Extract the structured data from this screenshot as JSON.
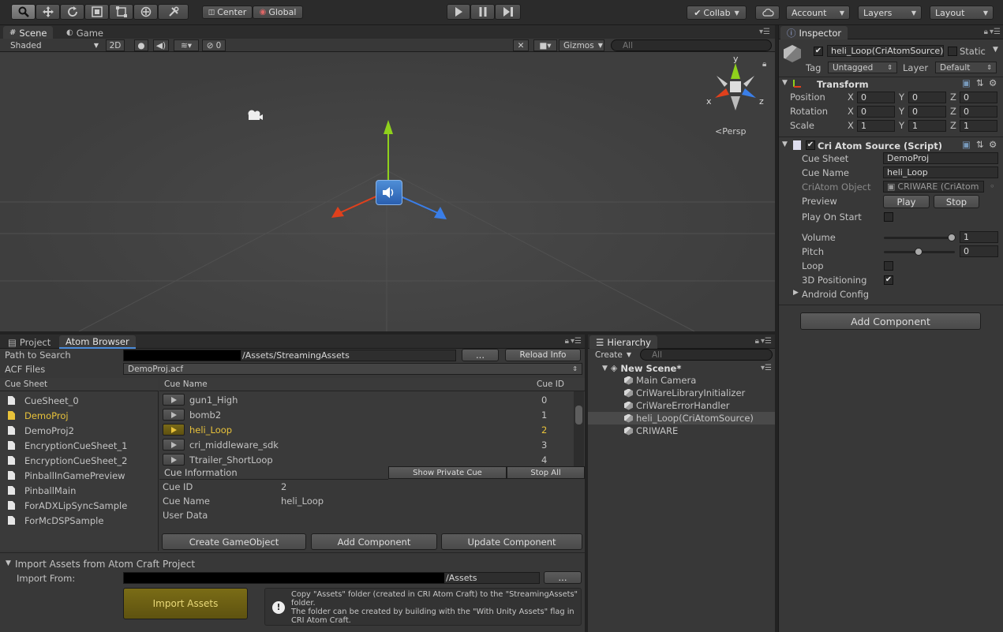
{
  "toolbar": {
    "pivot": "Center",
    "space": "Global",
    "collab": "Collab",
    "account": "Account",
    "layers": "Layers",
    "layout": "Layout"
  },
  "scene": {
    "tab_scene": "Scene",
    "tab_game": "Game",
    "shading": "Shaded",
    "mode_2d": "2D",
    "hidden_count": "0",
    "gizmos": "Gizmos",
    "search_placeholder": "All",
    "axis_y": "y",
    "axis_x": "x",
    "axis_z": "z",
    "persp": "Persp"
  },
  "inspector": {
    "tab": "Inspector",
    "object_name": "heli_Loop(CriAtomSource)",
    "static_label": "Static",
    "tag_label": "Tag",
    "tag_value": "Untagged",
    "layer_label": "Layer",
    "layer_value": "Default",
    "transform": {
      "title": "Transform",
      "rows": [
        {
          "label": "Position",
          "x": "0",
          "y": "0",
          "z": "0"
        },
        {
          "label": "Rotation",
          "x": "0",
          "y": "0",
          "z": "0"
        },
        {
          "label": "Scale",
          "x": "1",
          "y": "1",
          "z": "1"
        }
      ]
    },
    "source": {
      "title": "Cri Atom Source (Script)",
      "cue_sheet_label": "Cue Sheet",
      "cue_sheet": "DemoProj",
      "cue_name_label": "Cue Name",
      "cue_name": "heli_Loop",
      "criatom_object_label": "CriAtom Object",
      "criatom_object": "CRIWARE (CriAtom",
      "preview_label": "Preview",
      "play": "Play",
      "stop": "Stop",
      "play_on_start_label": "Play On Start",
      "play_on_start": false,
      "volume_label": "Volume",
      "volume": "1",
      "pitch_label": "Pitch",
      "pitch": "0",
      "loop_label": "Loop",
      "loop": false,
      "positioning_label": "3D Positioning",
      "positioning": true,
      "android_label": "Android Config"
    },
    "add_component": "Add Component"
  },
  "atom_browser": {
    "tab_project": "Project",
    "tab_atom": "Atom Browser",
    "path_label": "Path to Search",
    "path_value": "/Assets/StreamingAssets",
    "browse": "...",
    "reload": "Reload Info",
    "acf_label": "ACF Files",
    "acf_value": "DemoProj.acf",
    "cue_sheet_header": "Cue Sheet",
    "cue_name_header": "Cue Name",
    "cue_id_header": "Cue ID",
    "cue_sheets": [
      "CueSheet_0",
      "DemoProj",
      "DemoProj2",
      "EncryptionCueSheet_1",
      "EncryptionCueSheet_2",
      "PinballInGamePreview",
      "PinballMain",
      "ForADXLipSyncSample",
      "ForMcDSPSample"
    ],
    "selected_sheet": 1,
    "cues": [
      {
        "name": "gun1_High",
        "id": "0"
      },
      {
        "name": "bomb2",
        "id": "1"
      },
      {
        "name": "heli_Loop",
        "id": "2"
      },
      {
        "name": "cri_middleware_sdk",
        "id": "3"
      },
      {
        "name": "Ttrailer_ShortLoop",
        "id": "4"
      }
    ],
    "selected_cue": 2,
    "cue_info_title": "Cue Information",
    "show_private": "Show Private Cue",
    "stop_all": "Stop All",
    "info_id_label": "Cue ID",
    "info_id": "2",
    "info_name_label": "Cue Name",
    "info_name": "heli_Loop",
    "user_data_label": "User Data",
    "create_go": "Create GameObject",
    "add_component": "Add Component",
    "update_component": "Update Component",
    "import_title": "Import Assets from Atom Craft Project",
    "import_from_label": "Import From:",
    "import_path": "/Assets",
    "import_browse": "...",
    "import_button": "Import Assets",
    "note": "Copy \"Assets\" folder (created in CRI Atom Craft) to the \"StreamingAssets\" folder.\nThe folder can be created by building with the \"With Unity Assets\" flag in CRI Atom Craft."
  },
  "hierarchy": {
    "tab": "Hierarchy",
    "create": "Create",
    "search_placeholder": "All",
    "scene_name": "New Scene*",
    "items": [
      "Main Camera",
      "CriWareLibraryInitializer",
      "CriWareErrorHandler",
      "heli_Loop(CriAtomSource)",
      "CRIWARE"
    ],
    "selected": 3
  },
  "colors": {
    "accent_yellow": "#e8c23a",
    "import_button": "#6b5f12",
    "axis_x": "#e0401c",
    "axis_y": "#8fd11c",
    "axis_z": "#3a7ee8"
  }
}
